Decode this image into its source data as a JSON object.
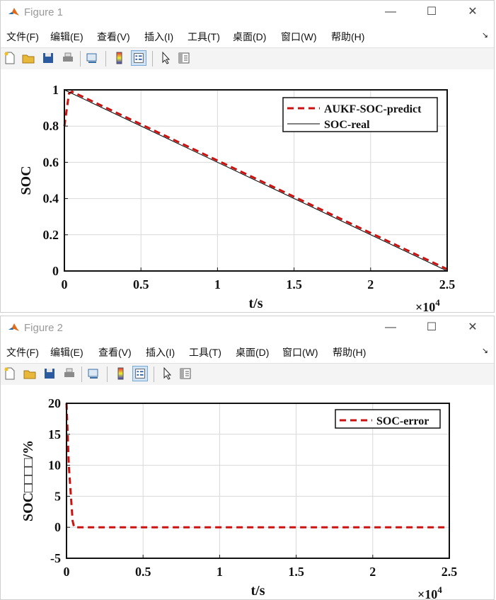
{
  "windows": [
    {
      "title": "Figure 1",
      "menu": [
        "文件(F)",
        "编辑(E)",
        "查看(V)",
        "插入(I)",
        "工具(T)",
        "桌面(D)",
        "窗口(W)",
        "帮助(H)"
      ],
      "controls": {
        "minimize": "—",
        "maximize": "☐",
        "close": "✕"
      }
    },
    {
      "title": "Figure 2",
      "menu": [
        "文件(F)",
        "编辑(E)",
        "查看(V)",
        "插入(I)",
        "工具(T)",
        "桌面(D)",
        "窗口(W)",
        "帮助(H)"
      ],
      "controls": {
        "minimize": "—",
        "maximize": "☐",
        "close": "✕"
      }
    }
  ],
  "toolbar_icons": [
    "new-figure-icon",
    "open-file-icon",
    "save-icon",
    "print-icon",
    "link-plot-icon",
    "colorbar-icon",
    "legend-icon",
    "pointer-icon",
    "property-inspector-icon"
  ],
  "colors": {
    "predict": "#cc1111",
    "real": "#000000",
    "grid": "#d9d9d9"
  },
  "chart_data": [
    {
      "type": "line",
      "xlabel": "t/s",
      "ylabel": "SOC",
      "x_exponent": "×10",
      "x_exponent_power": "4",
      "xlim": [
        0,
        25000
      ],
      "ylim": [
        0,
        1
      ],
      "xticks": [
        0,
        5000,
        10000,
        15000,
        20000,
        25000
      ],
      "xtick_labels": [
        "0",
        "0.5",
        "1",
        "1.5",
        "2",
        "2.5"
      ],
      "yticks": [
        0,
        0.2,
        0.4,
        0.6,
        0.8,
        1
      ],
      "ytick_labels": [
        "0",
        "0.2",
        "0.4",
        "0.6",
        "0.8",
        "1"
      ],
      "grid": true,
      "legend": "top-right",
      "series": [
        {
          "name": "AUKF-SOC-predict",
          "style": "dashed",
          "color": "#cc1111",
          "x": [
            0,
            300,
            500,
            25000
          ],
          "y": [
            0.8,
            0.98,
            0.99,
            0.01
          ]
        },
        {
          "name": "SOC-real",
          "style": "solid",
          "color": "#000000",
          "x": [
            0,
            25000
          ],
          "y": [
            1.0,
            0.0
          ]
        }
      ]
    },
    {
      "type": "line",
      "xlabel": "t/s",
      "ylabel": "SOC□□□□/%",
      "x_exponent": "×10",
      "x_exponent_power": "4",
      "xlim": [
        0,
        25000
      ],
      "ylim": [
        -5,
        20
      ],
      "xticks": [
        0,
        5000,
        10000,
        15000,
        20000,
        25000
      ],
      "xtick_labels": [
        "0",
        "0.5",
        "1",
        "1.5",
        "2",
        "2.5"
      ],
      "yticks": [
        -5,
        0,
        5,
        10,
        15,
        20
      ],
      "ytick_labels": [
        "-5",
        "0",
        "5",
        "10",
        "15",
        "20"
      ],
      "grid": true,
      "legend": "top-right",
      "series": [
        {
          "name": "SOC-error",
          "style": "dashed",
          "color": "#cc1111",
          "x": [
            0,
            150,
            400,
            500,
            25000
          ],
          "y": [
            20,
            10,
            1,
            0,
            0
          ]
        }
      ]
    }
  ]
}
